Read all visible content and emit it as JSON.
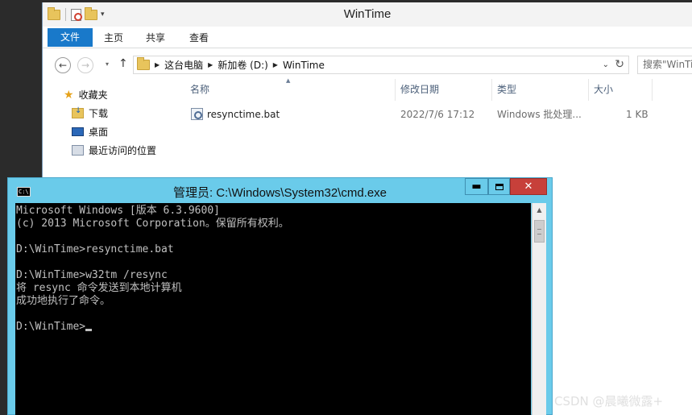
{
  "explorer": {
    "title": "WinTime",
    "ribbon_tabs": [
      "文件",
      "主页",
      "共享",
      "查看"
    ],
    "address": {
      "segments": [
        "这台电脑",
        "新加卷 (D:)",
        "WinTime"
      ]
    },
    "search_placeholder": "搜索\"WinTime\"",
    "nav_pane": {
      "favorites": "收藏夹",
      "items": [
        "下载",
        "桌面",
        "最近访问的位置"
      ]
    },
    "columns": [
      "名称",
      "修改日期",
      "类型",
      "大小"
    ],
    "files": [
      {
        "name": "resynctime.bat",
        "modified": "2022/7/6 17:12",
        "type": "Windows 批处理...",
        "size": "1 KB"
      }
    ]
  },
  "cmd": {
    "icon_text": "C:\\",
    "title": "管理员: C:\\Windows\\System32\\cmd.exe",
    "buttons": {
      "minimize": "▬",
      "close": "✕"
    },
    "lines": [
      "Microsoft Windows [版本 6.3.9600]",
      "(c) 2013 Microsoft Corporation。保留所有权利。",
      "",
      "D:\\WinTime>resynctime.bat",
      "",
      "D:\\WinTime>w32tm /resync",
      "将 resync 命令发送到本地计算机",
      "成功地执行了命令。",
      "",
      "D:\\WinTime>"
    ]
  },
  "watermark": "CSDN @晨曦微露+"
}
